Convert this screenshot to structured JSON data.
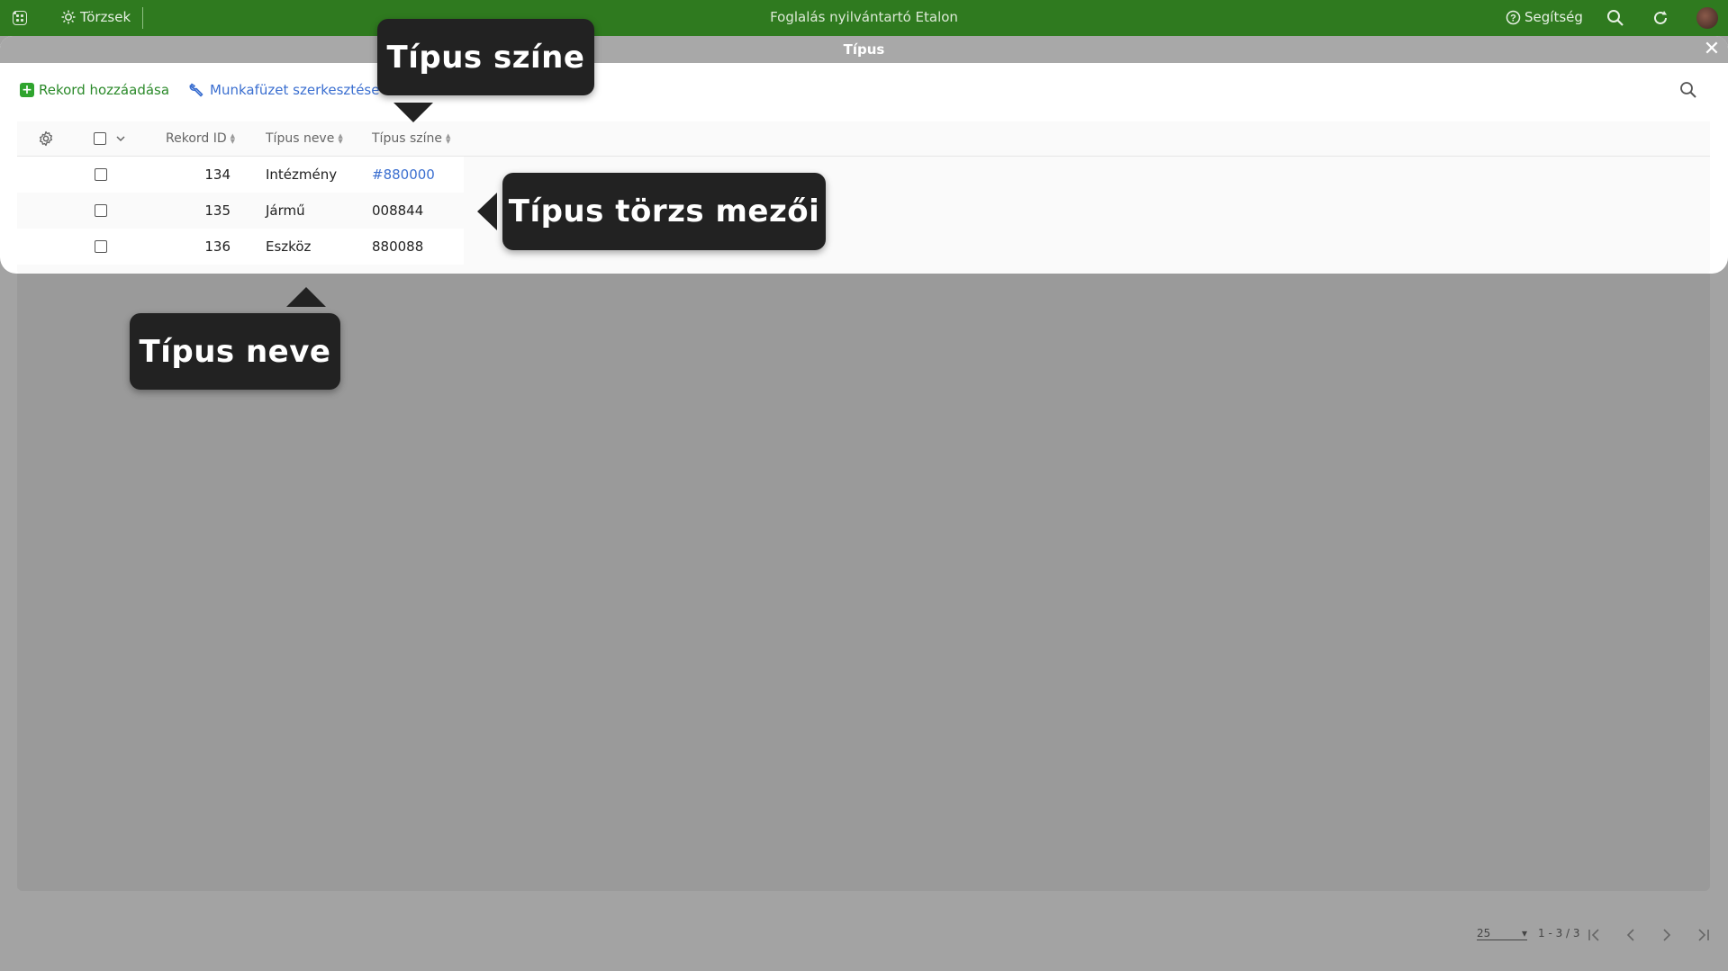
{
  "topbar": {
    "menu_label": "Törzsek",
    "app_title": "Foglalás nyilvántartó Etalon",
    "help_label": "Segítség",
    "bg_color": "#2f7a1f"
  },
  "modal": {
    "title": "Típus",
    "toolbar": {
      "add_label": "Rekord hozzáadása",
      "edit_label": "Munkafüzet szerkesztése"
    }
  },
  "table": {
    "columns": [
      "Rekord ID",
      "Típus neve",
      "Típus színe"
    ],
    "rows": [
      {
        "id": "134",
        "name": "Intézmény",
        "color": "#880000"
      },
      {
        "id": "135",
        "name": "Jármű",
        "color": "008844"
      },
      {
        "id": "136",
        "name": "Eszköz",
        "color": "880088"
      }
    ]
  },
  "pagination": {
    "page_size": "25",
    "range": "1 - 3 / 3"
  },
  "callouts": {
    "color": "Típus színe",
    "fields": "Típus törzs mezői",
    "name": "Típus neve"
  }
}
